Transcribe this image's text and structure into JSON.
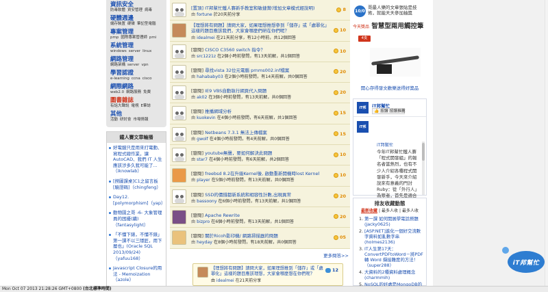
{
  "sidebar": {
    "categories": [
      {
        "title": "資訊安全",
        "subs": [
          "防毒軟體",
          "資安管理",
          "病毒"
        ],
        "red": false
      },
      {
        "title": "硬體週邊",
        "subs": [
          "儲存裝置",
          "硬碟",
          "筆記型電腦"
        ],
        "red": false
      },
      {
        "title": "專案管理",
        "subs": [
          "pmp",
          "國際專案管理師",
          "pmi"
        ],
        "red": false
      },
      {
        "title": "系統管理",
        "subs": [
          "windows",
          "server",
          "linux"
        ],
        "red": false
      },
      {
        "title": "網路管理",
        "subs": [
          "網路架構",
          "server",
          "vpn"
        ],
        "red": false
      },
      {
        "title": "學習認證",
        "subs": [
          "e-learning",
          "ccna",
          "cisco"
        ],
        "red": false
      },
      {
        "title": "網際網路",
        "subs": [
          "web2.0",
          "網路服務",
          "免費"
        ],
        "red": false
      },
      {
        "title": "圖書雜誌",
        "subs": [
          "有話大聲說",
          "電視",
          "E筆誌"
        ],
        "red": true
      },
      {
        "title": "其他",
        "subs": [
          "活動",
          "研討會",
          "市場情報"
        ],
        "red": false
      }
    ],
    "iron_title": "鐵人賽文章輪播",
    "iron_items": [
      "好電腦只是用來打電動、寫程式總作業，讓AutoCAD、我們 IT 人生應該涉多久我可能了...（iknowlab）",
      "[撈圖課桌]C1之留言板[驗證碼]（chingfeng）",
      "Day12.[polymorphism]（yap）",
      "動物園之哥 -6- 大象管理員的困擾(續)（fantasylight）",
      "「不懂下錶，不懂不錶」第一課不以三隱匠，用下層也」(Oracle SQL 2013/09/24)（yafuu168）",
      "Javascript Closure的用法 - Memoization（azole）"
    ]
  },
  "main": {
    "rows": [
      {
        "title": "[置頂] IT邦幫忙鐵人賽新手教室和敏捷賞(增加文章模式經說明)",
        "tag": "",
        "author": "fortune",
        "meta": "於20天前分享",
        "score": "8",
        "two": false,
        "av": "owl",
        "coin": true
      },
      {
        "title": "【理想將有問題】請問大家，如果理想推想參到「儲存」或「處罪化」這樣的題目應該我們，大家會哪麼們研在你們呢？",
        "tag": "",
        "author": "idealmei",
        "meta": "在21天前分享，有12小時前，共12個回答",
        "score": "10",
        "two": true,
        "av": "tint1",
        "coin": true
      },
      {
        "title": "CISCO C3560 switch 指令？",
        "tag": "[發問] ",
        "author": "src1221z",
        "meta": "在2個小時前發問，有13天前解，共1個回答",
        "score": "10",
        "two": false,
        "av": "owl",
        "coin": true
      },
      {
        "title": "尋找vista 32位元電腦 prnms002.inf檔案",
        "tag": "[發問] ",
        "author": "hahababy03",
        "meta": "在2個小時前發問，有14天前解，共0個回答",
        "score": "20",
        "two": false,
        "av": "owl",
        "coin": true
      },
      {
        "title": "IE9 VBS自動執行網頁代入問題",
        "tag": "[發問] ",
        "author": "ak02",
        "meta": "在3個小時前發問，有13天前解，共0個回答",
        "score": "20",
        "two": false,
        "av": "owl",
        "coin": true
      },
      {
        "title": "推播網域分析",
        "tag": "[發問] ",
        "author": "kuokevin",
        "meta": "在4個小時前發問，有6天前解，共1個回答",
        "score": "15",
        "two": false,
        "av": "owl",
        "coin": true
      },
      {
        "title": "Netbeans 7.3.1 無法上傳檔案",
        "tag": "[發問] ",
        "author": "gwolf",
        "meta": "在4個小時前發問，有4天前解，共0個回答",
        "score": "15",
        "two": false,
        "av": "owl",
        "coin": true
      },
      {
        "title": "youtube無聲，要如何解決此問題",
        "tag": "[發問] ",
        "author": "star7",
        "meta": "在4個小時前發問，有6天前解，共2個回答",
        "score": "10",
        "two": false,
        "av": "owl",
        "coin": true
      },
      {
        "title": "freebsd 8.2在升級Kernel後, 啟動重新開機時lost Kernel",
        "tag": "[發問] ",
        "author": "player",
        "meta": "在5個小時前發問，有13天前解，共0個回答",
        "score": "10",
        "two": false,
        "av": "tint2",
        "coin": true
      },
      {
        "title": "SSD的價錢都新系統和相容性計數,出現異常",
        "tag": "[發問] ",
        "author": "bassoony",
        "meta": "在6個小時前發問，有13天前解，共1個回答",
        "score": "20",
        "two": false,
        "av": "owl",
        "coin": true
      },
      {
        "title": "Apache Rewrite",
        "tag": "[發問] ",
        "author": "bizpro",
        "meta": "在6個小時前發問，有13天前解，共1個回答",
        "score": "20",
        "two": false,
        "av": "tint3",
        "coin": true
      },
      {
        "title": "關於Ricoh影印機/ 網路掃描器的問題",
        "tag": "[發問] ",
        "author": "heyday",
        "meta": "在8個小時前發問，有18天前解，共0個回答",
        "score": "05",
        "two": false,
        "av": "tint4",
        "coin": true
      }
    ],
    "more_label": "更多問答>>",
    "reply_card": {
      "title": "【理想將有問題】請問大家，如果理想推到「儲存」或「處罪化」這樣的題目應該理想，大家會哪麼想在你們呢？",
      "author": "idealmei",
      "meta": "在21天前分享",
      "badge": "12"
    }
  },
  "right": {
    "ad_top": {
      "num": "10/0",
      "text": "哥最人樂的文章張貼是技術，就能天天參加抽獎"
    },
    "ad_main": {
      "prize_tag": "今天獎品",
      "prize": "智慧型兩用觸控筆",
      "label": "4支",
      "caption": "開心存得發文歡樂送得好獎品"
    },
    "fb": {
      "logo": "iT邦",
      "name": "iT邦幫忙",
      "like": "👍 按讚 按讚推薦",
      "post_name": "iT邦幫忙",
      "post_text": "今年IT邦幫忙鐵人賽「程式開發組」的報名者當熱烈，也有不少人介紹各種程式開發新手，今天來介紹說來有意義的門討Ruby：從「外行人」為眾者，首先是適合入門的系列文章，"
    },
    "rank": {
      "title": "排友收藏動態",
      "tabs": [
        "最新收藏",
        "最多人收",
        "最多人收"
      ],
      "items": [
        {
          "no": "1.",
          "text": "第一課 如何開展學電話撈題(jacky0625)"
        },
        {
          "no": "2.",
          "text": "[ASP.NET]進化一個好交流數字資料如亂數字串(holmes2136)"
        },
        {
          "no": "3.",
          "text": "IT人生第17天：ConvertPDFtoWord－將PDF 轉 Word 擷接難度的方法！（super288）"
        },
        {
          "no": "4.",
          "text": "大資料的2種資料處理概念(charmmih)"
        },
        {
          "no": "5.",
          "text": "NoSQL的好處是MongoDB的"
        }
      ]
    },
    "mascot": "iT邦幫忙"
  },
  "status_bar": {
    "time": "Mon Oct 07 2013 21:28:26 GMT+0800",
    "zone": "(台北標準時間)"
  }
}
